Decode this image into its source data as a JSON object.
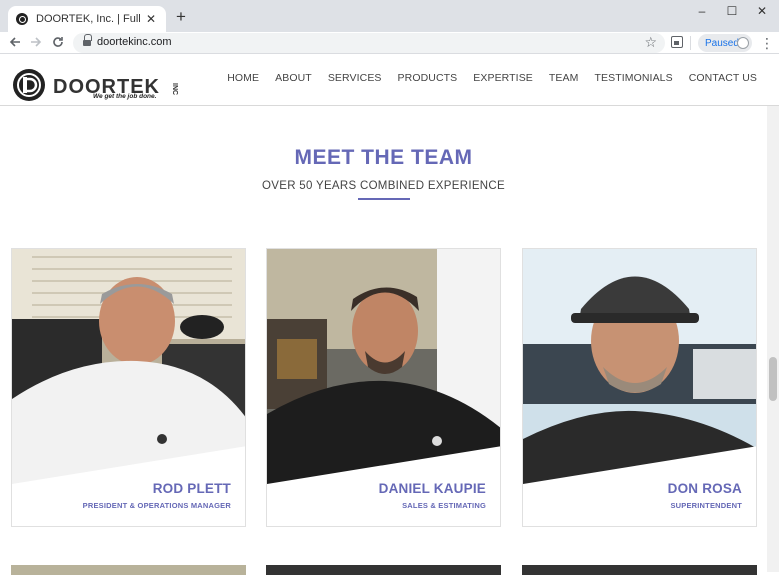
{
  "browser": {
    "tab_title": "DOORTEK, Inc. | Full Service Doo",
    "tab_close": "✕",
    "new_tab": "+",
    "url": "doortekinc.com",
    "paused_label": "Paused",
    "window_controls": [
      "–",
      "☐",
      "✕"
    ],
    "nav_icons": [
      "back-arrow-icon",
      "forward-arrow-icon",
      "reload-icon"
    ]
  },
  "site": {
    "logo_text": "DOORTEK",
    "logo_inc": "INC",
    "logo_tagline": "We get the job done.",
    "nav": [
      "HOME",
      "ABOUT",
      "SERVICES",
      "PRODUCTS",
      "EXPERTISE",
      "TEAM",
      "TESTIMONIALS",
      "CONTACT US"
    ]
  },
  "team": {
    "title": "MEET THE TEAM",
    "subtitle": "OVER 50 YEARS COMBINED EXPERIENCE",
    "members": [
      {
        "name": "ROD PLETT",
        "role": "PRESIDENT & OPERATIONS MANAGER"
      },
      {
        "name": "DANIEL KAUPIE",
        "role": "SALES & ESTIMATING"
      },
      {
        "name": "DON ROSA",
        "role": "SUPERINTENDENT"
      }
    ]
  },
  "colors": {
    "accent": "#6568b6",
    "chrome_bg": "#dee1e6"
  }
}
